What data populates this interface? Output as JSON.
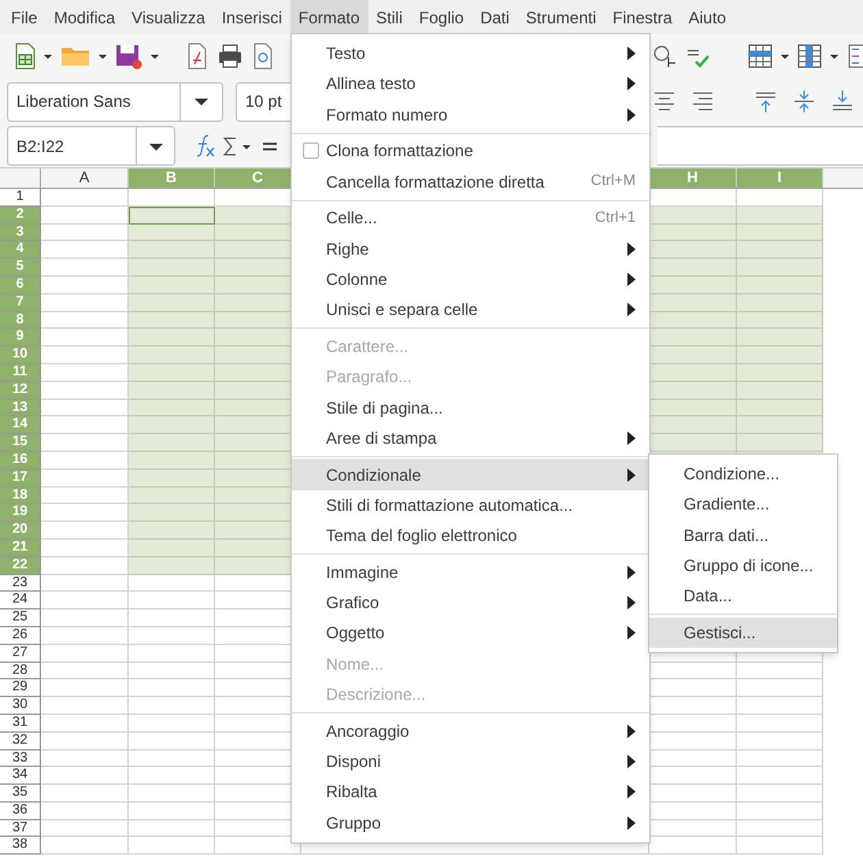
{
  "menubar": [
    {
      "label": "File",
      "selected": false
    },
    {
      "label": "Modifica",
      "selected": false
    },
    {
      "label": "Visualizza",
      "selected": false
    },
    {
      "label": "Inserisci",
      "selected": false
    },
    {
      "label": "Formato",
      "selected": true
    },
    {
      "label": "Stili",
      "selected": false
    },
    {
      "label": "Foglio",
      "selected": false
    },
    {
      "label": "Dati",
      "selected": false
    },
    {
      "label": "Strumenti",
      "selected": false
    },
    {
      "label": "Finestra",
      "selected": false
    },
    {
      "label": "Aiuto",
      "selected": false
    }
  ],
  "font_name": {
    "value": "Liberation Sans"
  },
  "font_size": {
    "value": "10 pt"
  },
  "name_box": {
    "value": "B2:I22"
  },
  "columns": [
    {
      "label": "A",
      "selected": false
    },
    {
      "label": "B",
      "selected": true
    },
    {
      "label": "C",
      "selected": true
    },
    {
      "label": "H",
      "selected": true
    },
    {
      "label": "I",
      "selected": true
    }
  ],
  "rows": [
    {
      "label": "1",
      "selected": false
    },
    {
      "label": "2",
      "selected": true
    },
    {
      "label": "3",
      "selected": true
    },
    {
      "label": "4",
      "selected": true
    },
    {
      "label": "5",
      "selected": true
    },
    {
      "label": "6",
      "selected": true
    },
    {
      "label": "7",
      "selected": true
    },
    {
      "label": "8",
      "selected": true
    },
    {
      "label": "9",
      "selected": true
    },
    {
      "label": "10",
      "selected": true
    },
    {
      "label": "11",
      "selected": true
    },
    {
      "label": "12",
      "selected": true
    },
    {
      "label": "13",
      "selected": true
    },
    {
      "label": "14",
      "selected": true
    },
    {
      "label": "15",
      "selected": true
    },
    {
      "label": "16",
      "selected": true
    },
    {
      "label": "17",
      "selected": true
    },
    {
      "label": "18",
      "selected": true
    },
    {
      "label": "19",
      "selected": true
    },
    {
      "label": "20",
      "selected": true
    },
    {
      "label": "21",
      "selected": true
    },
    {
      "label": "22",
      "selected": true
    },
    {
      "label": "23",
      "selected": false
    },
    {
      "label": "24",
      "selected": false
    },
    {
      "label": "25",
      "selected": false
    },
    {
      "label": "26",
      "selected": false
    },
    {
      "label": "27",
      "selected": false
    },
    {
      "label": "28",
      "selected": false
    },
    {
      "label": "29",
      "selected": false
    },
    {
      "label": "30",
      "selected": false
    },
    {
      "label": "31",
      "selected": false
    },
    {
      "label": "32",
      "selected": false
    },
    {
      "label": "33",
      "selected": false
    },
    {
      "label": "34",
      "selected": false
    },
    {
      "label": "35",
      "selected": false
    },
    {
      "label": "36",
      "selected": false
    },
    {
      "label": "37",
      "selected": false
    },
    {
      "label": "38",
      "selected": false
    }
  ],
  "format_menu": {
    "items": [
      {
        "kind": "item",
        "label": "Testo",
        "has_submenu": true,
        "disabled": false,
        "selected": false
      },
      {
        "kind": "item",
        "label": "Allinea testo",
        "has_submenu": true,
        "disabled": false,
        "selected": false
      },
      {
        "kind": "item",
        "label": "Formato numero",
        "has_submenu": true,
        "disabled": false,
        "selected": false
      },
      {
        "kind": "separator"
      },
      {
        "kind": "checkbox",
        "label": "Clona formattazione",
        "checked": false,
        "has_submenu": false,
        "disabled": false,
        "selected": false
      },
      {
        "kind": "item",
        "label": "Cancella formattazione diretta",
        "shortcut": "Ctrl+M",
        "has_submenu": false,
        "disabled": false,
        "selected": false
      },
      {
        "kind": "separator"
      },
      {
        "kind": "item",
        "label": "Celle...",
        "shortcut": "Ctrl+1",
        "has_submenu": false,
        "disabled": false,
        "selected": false
      },
      {
        "kind": "item",
        "label": "Righe",
        "has_submenu": true,
        "disabled": false,
        "selected": false
      },
      {
        "kind": "item",
        "label": "Colonne",
        "has_submenu": true,
        "disabled": false,
        "selected": false
      },
      {
        "kind": "item",
        "label": "Unisci e separa celle",
        "has_submenu": true,
        "disabled": false,
        "selected": false
      },
      {
        "kind": "separator"
      },
      {
        "kind": "item",
        "label": "Carattere...",
        "has_submenu": false,
        "disabled": true,
        "selected": false
      },
      {
        "kind": "item",
        "label": "Paragrafo...",
        "has_submenu": false,
        "disabled": true,
        "selected": false
      },
      {
        "kind": "item",
        "label": "Stile di pagina...",
        "has_submenu": false,
        "disabled": false,
        "selected": false
      },
      {
        "kind": "item",
        "label": "Aree di stampa",
        "has_submenu": true,
        "disabled": false,
        "selected": false
      },
      {
        "kind": "separator"
      },
      {
        "kind": "item",
        "label": "Condizionale",
        "has_submenu": true,
        "disabled": false,
        "selected": true
      },
      {
        "kind": "item",
        "label": "Stili di formattazione automatica...",
        "has_submenu": false,
        "disabled": false,
        "selected": false
      },
      {
        "kind": "item",
        "label": "Tema del foglio elettronico",
        "has_submenu": false,
        "disabled": false,
        "selected": false
      },
      {
        "kind": "separator"
      },
      {
        "kind": "item",
        "label": "Immagine",
        "has_submenu": true,
        "disabled": false,
        "selected": false
      },
      {
        "kind": "item",
        "label": "Grafico",
        "has_submenu": true,
        "disabled": false,
        "selected": false
      },
      {
        "kind": "item",
        "label": "Oggetto",
        "has_submenu": true,
        "disabled": false,
        "selected": false
      },
      {
        "kind": "item",
        "label": "Nome...",
        "has_submenu": false,
        "disabled": true,
        "selected": false
      },
      {
        "kind": "item",
        "label": "Descrizione...",
        "has_submenu": false,
        "disabled": true,
        "selected": false
      },
      {
        "kind": "separator"
      },
      {
        "kind": "item",
        "label": "Ancoraggio",
        "has_submenu": true,
        "disabled": false,
        "selected": false
      },
      {
        "kind": "item",
        "label": "Disponi",
        "has_submenu": true,
        "disabled": false,
        "selected": false
      },
      {
        "kind": "item",
        "label": "Ribalta",
        "has_submenu": true,
        "disabled": false,
        "selected": false
      },
      {
        "kind": "item",
        "label": "Gruppo",
        "has_submenu": true,
        "disabled": false,
        "selected": false
      }
    ]
  },
  "conditional_submenu": {
    "items": [
      {
        "kind": "item",
        "label": "Condizione...",
        "disabled": false,
        "selected": false
      },
      {
        "kind": "item",
        "label": "Gradiente...",
        "disabled": false,
        "selected": false
      },
      {
        "kind": "item",
        "label": "Barra dati...",
        "disabled": false,
        "selected": false
      },
      {
        "kind": "item",
        "label": "Gruppo di icone...",
        "disabled": false,
        "selected": false
      },
      {
        "kind": "item",
        "label": "Data...",
        "disabled": false,
        "selected": false
      },
      {
        "kind": "separator"
      },
      {
        "kind": "item",
        "label": "Gestisci...",
        "disabled": false,
        "selected": true
      }
    ]
  }
}
